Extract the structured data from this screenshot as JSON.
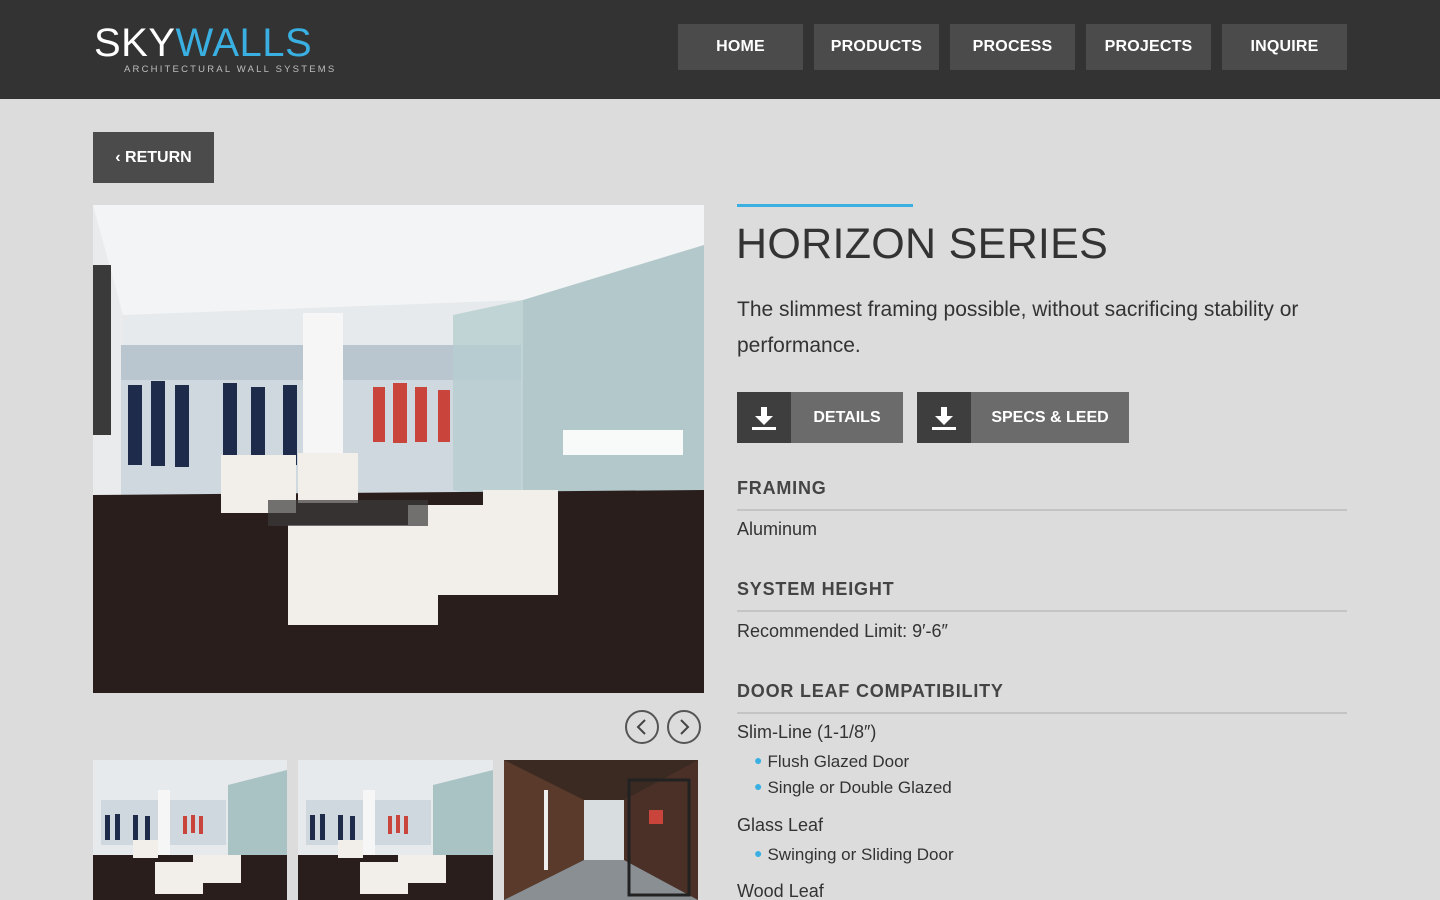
{
  "brand": {
    "name_part1": "SKY",
    "name_part2": "WALLS",
    "tagline": "ARCHITECTURAL WALL SYSTEMS",
    "accent_color": "#3ab0e2"
  },
  "nav": {
    "items": [
      {
        "label": "HOME"
      },
      {
        "label": "PRODUCTS"
      },
      {
        "label": "PROCESS"
      },
      {
        "label": "PROJECTS"
      },
      {
        "label": "INQUIRE"
      }
    ]
  },
  "return_button": {
    "label": "‹ RETURN"
  },
  "gallery": {
    "prev_icon": "chevron-left-icon",
    "next_icon": "chevron-right-icon"
  },
  "product": {
    "title": "HORIZON SERIES",
    "tagline": "The slimmest framing possible, without sacrificing stability or performance.",
    "downloads": [
      {
        "label": "DETAILS",
        "icon": "download-icon"
      },
      {
        "label": "SPECS & LEED",
        "icon": "download-icon"
      }
    ],
    "specs": {
      "framing": {
        "heading": "FRAMING",
        "value": "Aluminum"
      },
      "system_height": {
        "heading": "SYSTEM HEIGHT",
        "value": "Recommended Limit: 9′-6″"
      },
      "door_leaf": {
        "heading": "DOOR LEAF COMPATIBILITY",
        "groups": [
          {
            "name": "Slim-Line (1-1/8″)",
            "items": [
              "Flush Glazed Door",
              "Single or Double Glazed"
            ]
          },
          {
            "name": "Glass Leaf",
            "items": [
              "Swinging or Sliding Door"
            ]
          },
          {
            "name": "Wood Leaf",
            "items": []
          }
        ]
      }
    }
  }
}
